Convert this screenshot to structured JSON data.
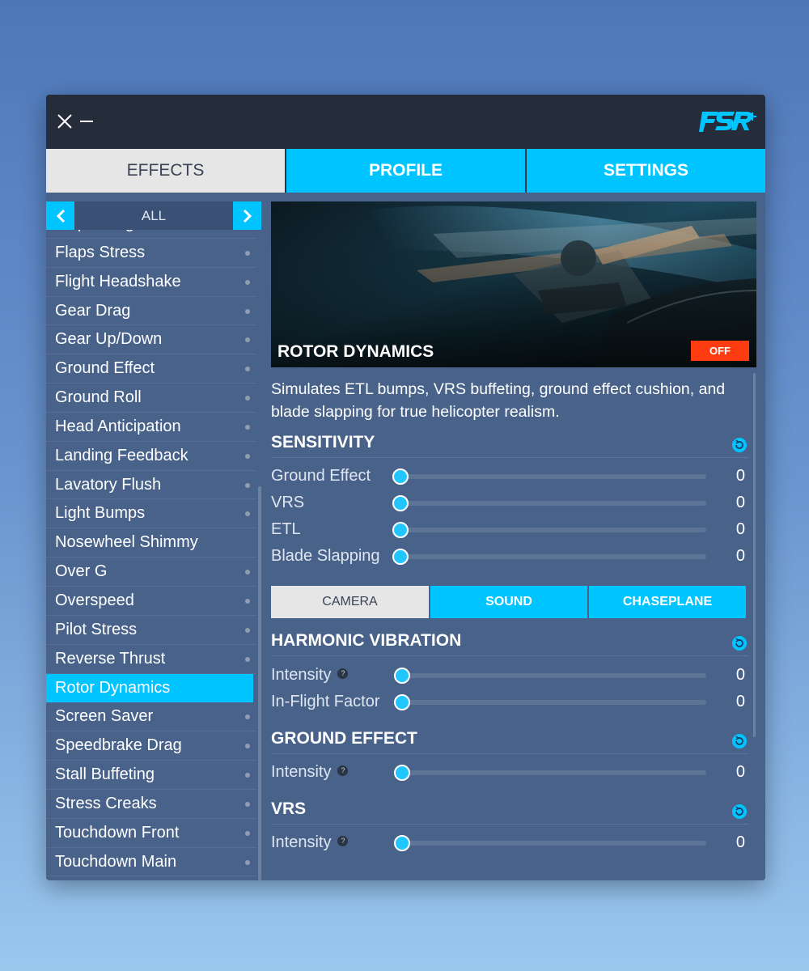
{
  "window": {
    "close_icon": "close-icon",
    "minimize_icon": "minimize-icon",
    "logo_text": "FSR+"
  },
  "tabs": [
    {
      "label": "EFFECTS",
      "active": true
    },
    {
      "label": "PROFILE",
      "active": false
    },
    {
      "label": "SETTINGS",
      "active": false
    }
  ],
  "sidebar": {
    "category": "ALL",
    "items": [
      "Flaps Drag",
      "Flaps Stress",
      "Flight Headshake",
      "Gear Drag",
      "Gear Up/Down",
      "Ground Effect",
      "Ground Roll",
      "Head Anticipation",
      "Landing Feedback",
      "Lavatory Flush",
      "Light Bumps",
      "Nosewheel Shimmy",
      "Over G",
      "Overspeed",
      "Pilot Stress",
      "Reverse Thrust",
      "Rotor Dynamics",
      "Screen Saver",
      "Speedbrake Drag",
      "Stall Buffeting",
      "Stress Creaks",
      "Touchdown Front",
      "Touchdown Main"
    ],
    "selected": "Rotor Dynamics"
  },
  "effect": {
    "title": "ROTOR DYNAMICS",
    "status": "OFF",
    "description": "Simulates ETL bumps, VRS buffeting, ground effect cushion, and blade slapping for true helicopter realism."
  },
  "sensitivity": {
    "title": "SENSITIVITY",
    "rows": [
      {
        "label": "Ground Effect",
        "value": "0"
      },
      {
        "label": "VRS",
        "value": "0"
      },
      {
        "label": "ETL",
        "value": "0"
      },
      {
        "label": "Blade Slapping",
        "value": "0"
      }
    ]
  },
  "subtabs": [
    {
      "label": "CAMERA",
      "active": true
    },
    {
      "label": "SOUND",
      "active": false
    },
    {
      "label": "CHASEPLANE",
      "active": false
    }
  ],
  "harmonic": {
    "title": "HARMONIC VIBRATION",
    "rows": [
      {
        "label": "Intensity",
        "value": "0",
        "help": "?"
      },
      {
        "label": "In-Flight Factor",
        "value": "0"
      }
    ]
  },
  "ground_effect": {
    "title": "GROUND EFFECT",
    "rows": [
      {
        "label": "Intensity",
        "value": "0",
        "help": "?"
      }
    ]
  },
  "vrs": {
    "title": "VRS",
    "rows": [
      {
        "label": "Intensity",
        "value": "0",
        "help": "?"
      }
    ]
  },
  "colors": {
    "accent": "#00c4ff",
    "off_badge": "#ff3b12",
    "panel": "#48628a",
    "titlebar": "#262d3a"
  }
}
